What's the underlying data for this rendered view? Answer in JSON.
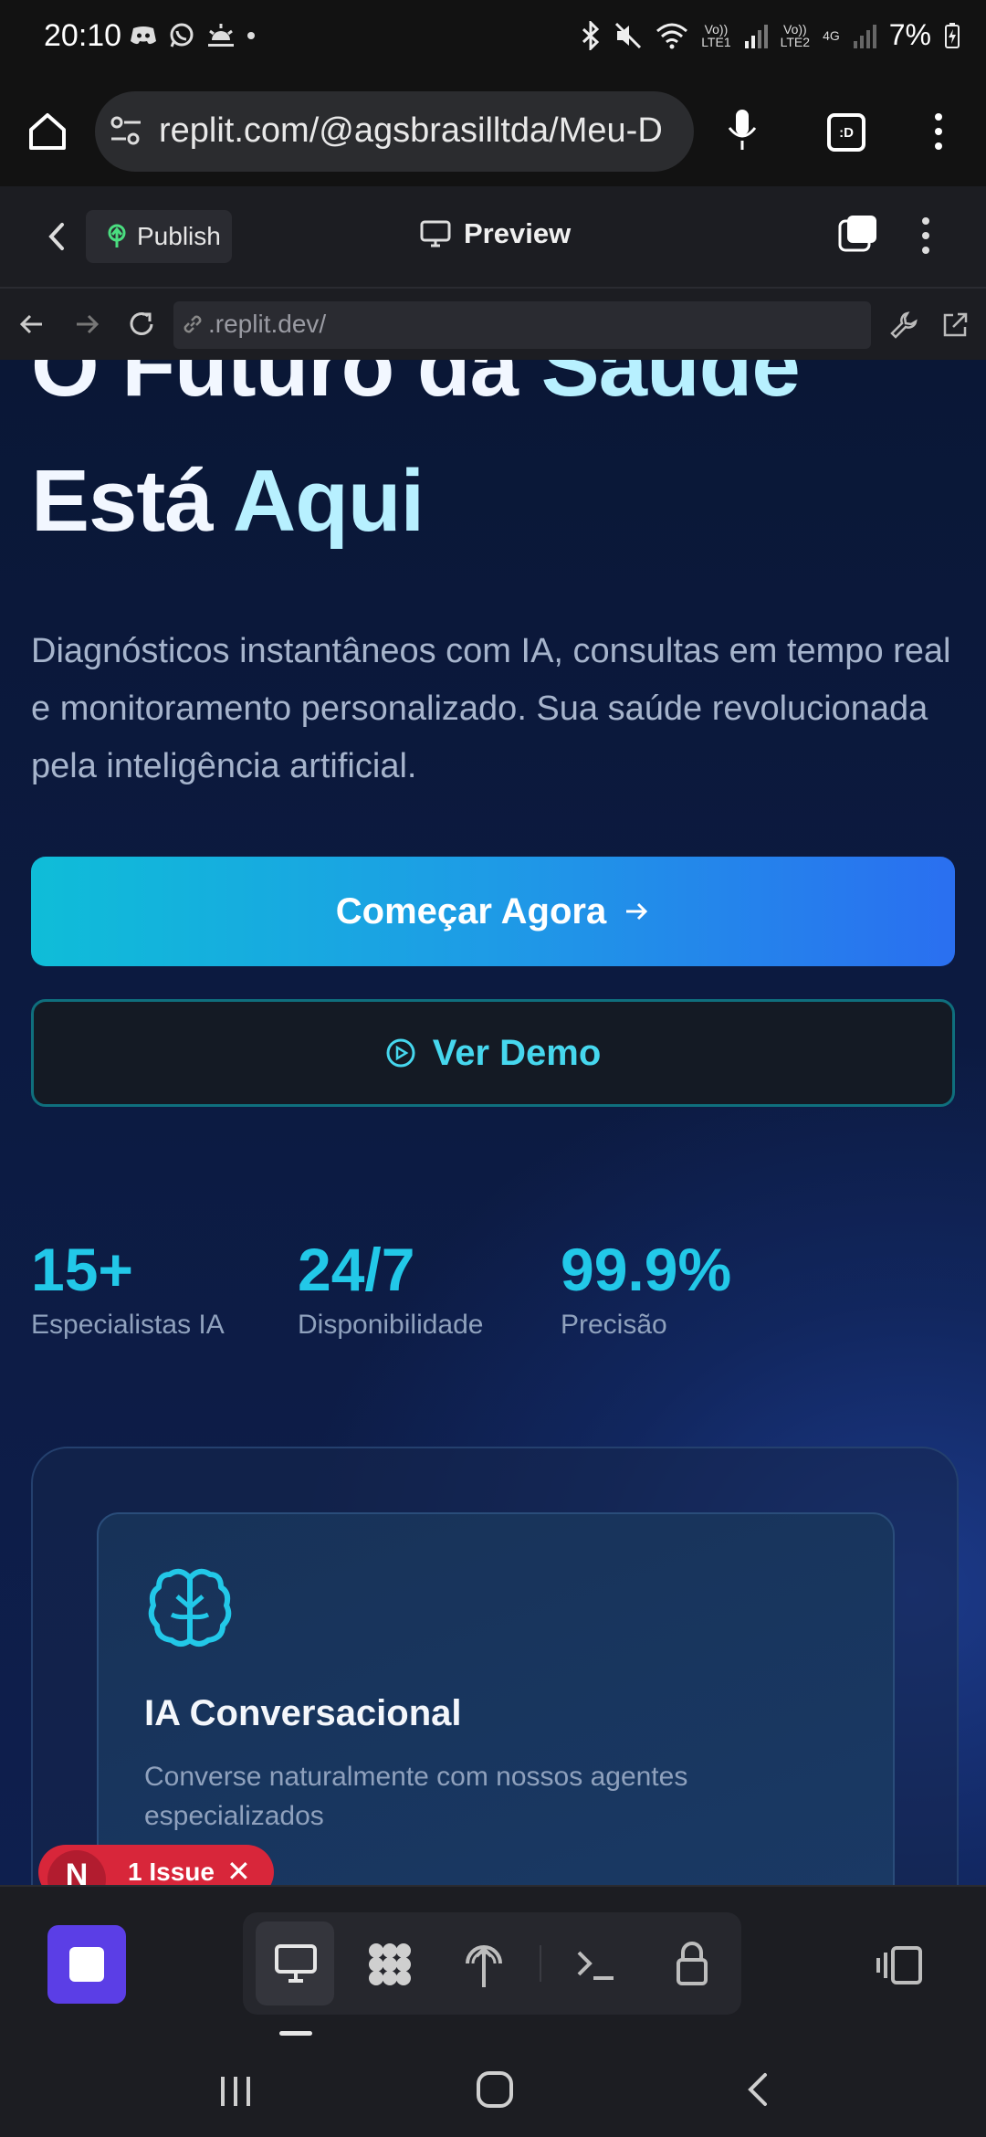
{
  "status_bar": {
    "time": "20:10",
    "battery": "7%",
    "lte1": "LTE1",
    "lte2": "LTE2",
    "net": "4G",
    "volte": "Vo))"
  },
  "browser": {
    "url": "replit.com/@agsbrasilltda/Meu-D",
    "tab_count": ":D"
  },
  "replit_header": {
    "publish_label": "Publish",
    "preview_label": "Preview"
  },
  "webview": {
    "address": ".replit.dev/"
  },
  "hero": {
    "title_line1_a": "O Futuro da",
    "title_line1_b": "Saúde",
    "title_line2_a": "Está",
    "title_line2_b": "Aqui",
    "description": "Diagnósticos instantâneos com IA, consultas em tempo real e monitoramento personalizado. Sua saúde revolucionada pela inteligência artificial.",
    "primary_cta": "Começar Agora",
    "secondary_cta": "Ver Demo"
  },
  "stats": [
    {
      "value": "15+",
      "label": "Especialistas IA"
    },
    {
      "value": "24/7",
      "label": "Disponibilidade"
    },
    {
      "value": "99.9%",
      "label": "Precisão"
    }
  ],
  "feature": {
    "title": "IA Conversacional",
    "description": "Converse naturalmente com nossos agentes especializados"
  },
  "issue_toast": {
    "avatar": "N",
    "label": "1 Issue"
  },
  "colors": {
    "accent_cyan": "#22c8e8",
    "cta_gradient_start": "#0fbdd8",
    "cta_gradient_end": "#2a6ff0",
    "stop_button": "#5b3ee6",
    "issue_red": "#d8263a"
  }
}
